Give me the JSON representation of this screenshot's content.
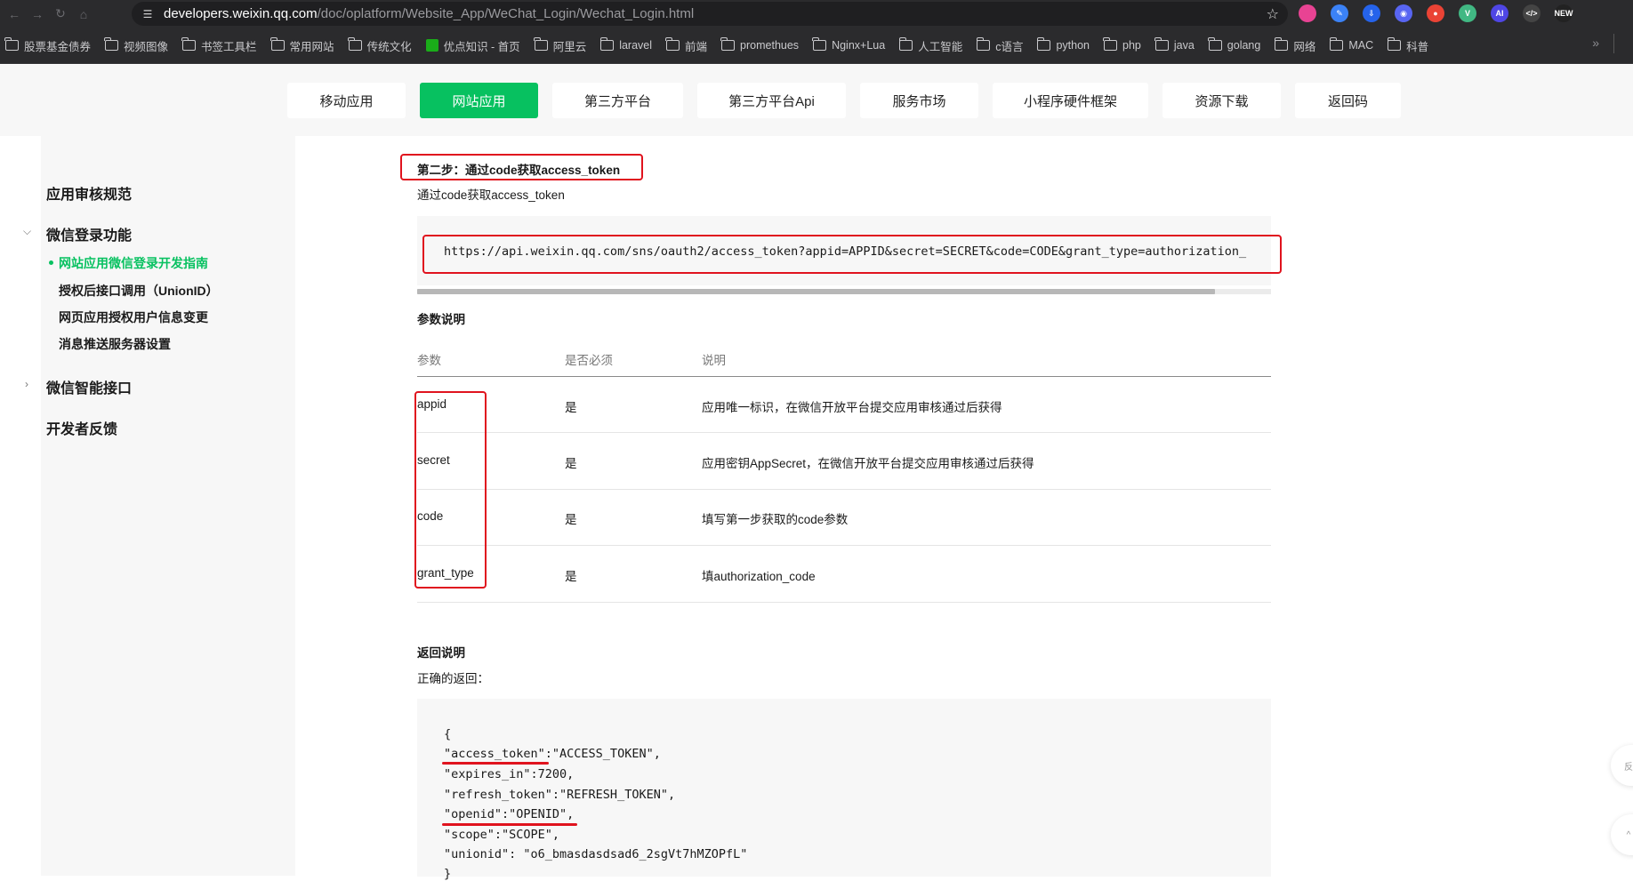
{
  "browser": {
    "url_host": "developers.weixin.qq.com",
    "url_path": "/doc/oplatform/Website_App/WeChat_Login/Wechat_Login.html",
    "bookmarks": [
      {
        "label": "股票基金债券",
        "icon": "folder-icon"
      },
      {
        "label": "视频图像",
        "icon": "folder-icon"
      },
      {
        "label": "书签工具栏",
        "icon": "folder-icon"
      },
      {
        "label": "常用网站",
        "icon": "folder-icon"
      },
      {
        "label": "传统文化",
        "icon": "folder-icon"
      },
      {
        "label": "优点知识 - 首页",
        "icon": "site-icon"
      },
      {
        "label": "阿里云",
        "icon": "folder-icon"
      },
      {
        "label": "laravel",
        "icon": "folder-icon"
      },
      {
        "label": "前端",
        "icon": "folder-icon"
      },
      {
        "label": "promethues",
        "icon": "folder-icon"
      },
      {
        "label": "Nginx+Lua",
        "icon": "folder-icon"
      },
      {
        "label": "人工智能",
        "icon": "folder-icon"
      },
      {
        "label": "c语言",
        "icon": "folder-icon"
      },
      {
        "label": "python",
        "icon": "folder-icon"
      },
      {
        "label": "php",
        "icon": "folder-icon"
      },
      {
        "label": "java",
        "icon": "folder-icon"
      },
      {
        "label": "golang",
        "icon": "folder-icon"
      },
      {
        "label": "网络",
        "icon": "folder-icon"
      },
      {
        "label": "MAC",
        "icon": "folder-icon"
      },
      {
        "label": "科普",
        "icon": "folder-icon"
      }
    ],
    "extensions": [
      {
        "name": "color-ext-icon",
        "color": "#e84393",
        "text": ""
      },
      {
        "name": "pen-ext-icon",
        "color": "#3b82f6",
        "text": "✎"
      },
      {
        "name": "translate-ext-icon",
        "color": "#2563eb",
        "text": "⇩"
      },
      {
        "name": "discord-ext-icon",
        "color": "#5865f2",
        "text": "◉"
      },
      {
        "name": "chrome-ext-icon",
        "color": "#ea4335",
        "text": "●"
      },
      {
        "name": "vue-ext-icon",
        "color": "#41b883",
        "text": "V"
      },
      {
        "name": "ai-ext-icon",
        "color": "#4f46e5",
        "text": "AI"
      },
      {
        "name": "code-ext-icon",
        "color": "#444444",
        "text": "</>"
      },
      {
        "name": "new-ext-icon",
        "color": "#222222",
        "text": "NEW"
      }
    ]
  },
  "topnav": {
    "tabs": [
      "移动应用",
      "网站应用",
      "第三方平台",
      "第三方平台Api",
      "服务市场",
      "小程序硬件框架",
      "资源下载",
      "返回码"
    ],
    "active": "网站应用"
  },
  "sidebar": {
    "items": [
      "应用审核规范",
      "微信登录功能",
      "微信智能接口",
      "开发者反馈"
    ],
    "subitems": [
      "网站应用微信登录开发指南",
      "授权后接口调用（UnionID）",
      "网页应用授权用户信息变更",
      "消息推送服务器设置"
    ]
  },
  "content": {
    "step_title": "第二步：通过code获取access_token",
    "step_sub": "通过code获取access_token",
    "request_url": "https://api.weixin.qq.com/sns/oauth2/access_token?appid=APPID&secret=SECRET&code=CODE&grant_type=authorization_",
    "params_title": "参数说明",
    "table_headers": [
      "参数",
      "是否必须",
      "说明"
    ],
    "table_rows": [
      [
        "appid",
        "是",
        "应用唯一标识，在微信开放平台提交应用审核通过后获得"
      ],
      [
        "secret",
        "是",
        "应用密钥AppSecret，在微信开放平台提交应用审核通过后获得"
      ],
      [
        "code",
        "是",
        "填写第一步获取的code参数"
      ],
      [
        "grant_type",
        "是",
        "填authorization_code"
      ]
    ],
    "return_title": "返回说明",
    "return_sub": "正确的返回：",
    "json_lines": [
      "{",
      "\"access_token\":\"ACCESS_TOKEN\",",
      "\"expires_in\":7200,",
      "\"refresh_token\":\"REFRESH_TOKEN\",",
      "\"openid\":\"OPENID\",",
      "\"scope\":\"SCOPE\",",
      "\"unionid\": \"o6_bmasdasdsad6_2sgVt7hMZOPfL\"",
      "}"
    ]
  },
  "floating": [
    "反",
    "^"
  ],
  "colors": {
    "accent": "#07c160",
    "annotation": "#e0131e"
  }
}
